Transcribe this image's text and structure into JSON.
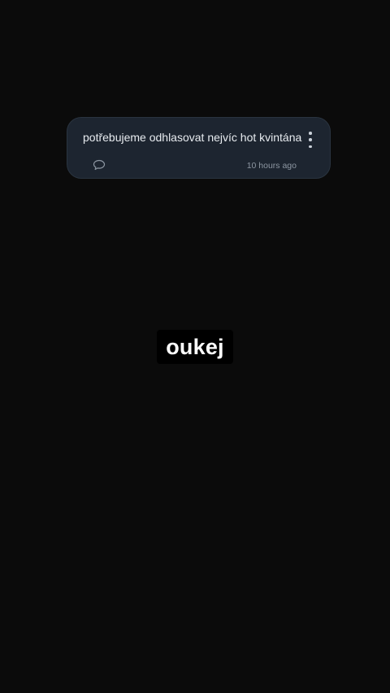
{
  "post": {
    "text": "potřebujeme odhlasovat nejvíc hot kvintána",
    "time": "10 hours ago",
    "comment_icon": "comment-icon",
    "more_icon": "more-vertical-icon"
  },
  "caption": {
    "text": "oukej"
  },
  "colors": {
    "background": "#0b0b0b",
    "card": "#1d2530",
    "caption_bg": "#000000",
    "caption_text": "#ffffff"
  }
}
